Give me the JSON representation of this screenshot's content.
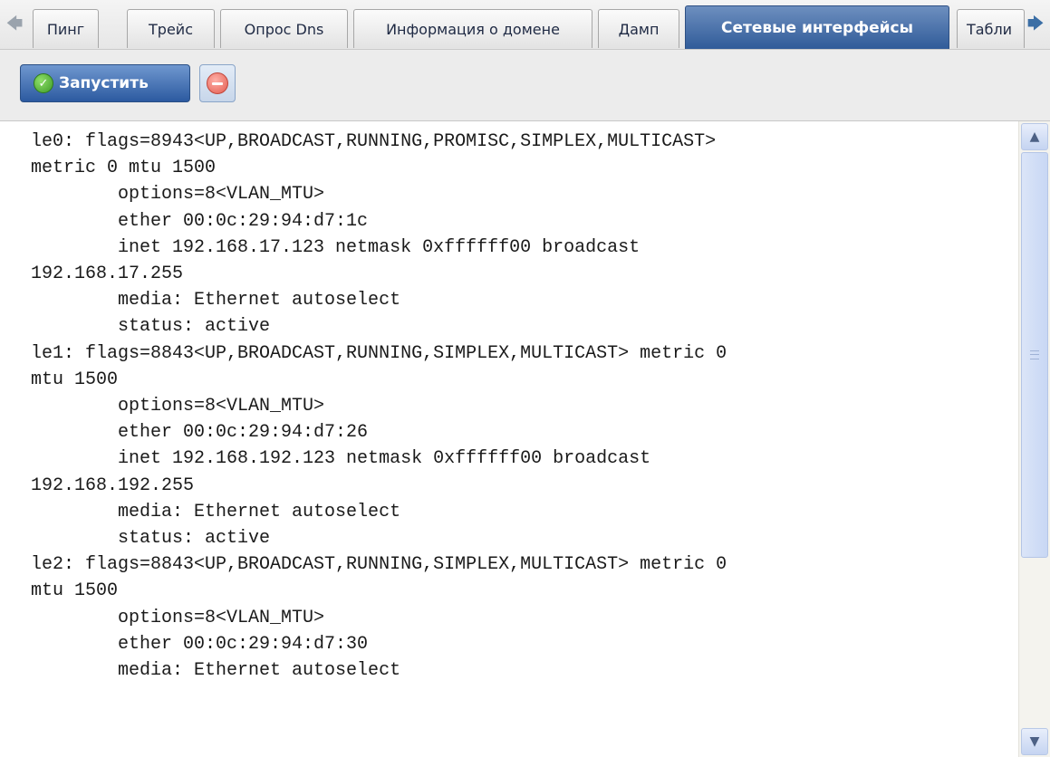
{
  "tabs": [
    {
      "label": "Пинг",
      "active": false
    },
    {
      "label": "Трейс",
      "active": false
    },
    {
      "label": "Опрос Dns",
      "active": false
    },
    {
      "label": "Информация о домене",
      "active": false
    },
    {
      "label": "Дамп",
      "active": false
    },
    {
      "label": "Сетевые интерфейсы",
      "active": true
    },
    {
      "label": "Табли",
      "active": false
    }
  ],
  "toolbar": {
    "run_label": "Запустить"
  },
  "output": {
    "lines": [
      "le0: flags=8943<UP,BROADCAST,RUNNING,PROMISC,SIMPLEX,MULTICAST>",
      "metric 0 mtu 1500",
      "        options=8<VLAN_MTU>",
      "        ether 00:0c:29:94:d7:1c",
      "        inet 192.168.17.123 netmask 0xffffff00 broadcast",
      "192.168.17.255",
      "        media: Ethernet autoselect",
      "        status: active",
      "le1: flags=8843<UP,BROADCAST,RUNNING,SIMPLEX,MULTICAST> metric 0",
      "mtu 1500",
      "        options=8<VLAN_MTU>",
      "        ether 00:0c:29:94:d7:26",
      "        inet 192.168.192.123 netmask 0xffffff00 broadcast",
      "192.168.192.255",
      "        media: Ethernet autoselect",
      "        status: active",
      "le2: flags=8843<UP,BROADCAST,RUNNING,SIMPLEX,MULTICAST> metric 0",
      "mtu 1500",
      "        options=8<VLAN_MTU>",
      "        ether 00:0c:29:94:d7:30",
      "        media: Ethernet autoselect"
    ]
  },
  "icons": {
    "run": "check-circle-icon",
    "stop": "stop-icon",
    "tab_scroll_left": "arrow-left-icon",
    "tab_scroll_right": "arrow-right-icon",
    "scroll_up": "chevron-up-icon",
    "scroll_down": "chevron-down-icon"
  },
  "colors": {
    "active_tab": "#2f5a98",
    "run_button": "#2c5aa0",
    "ok_icon": "#3e9a27",
    "stop_icon": "#e25b4f"
  }
}
